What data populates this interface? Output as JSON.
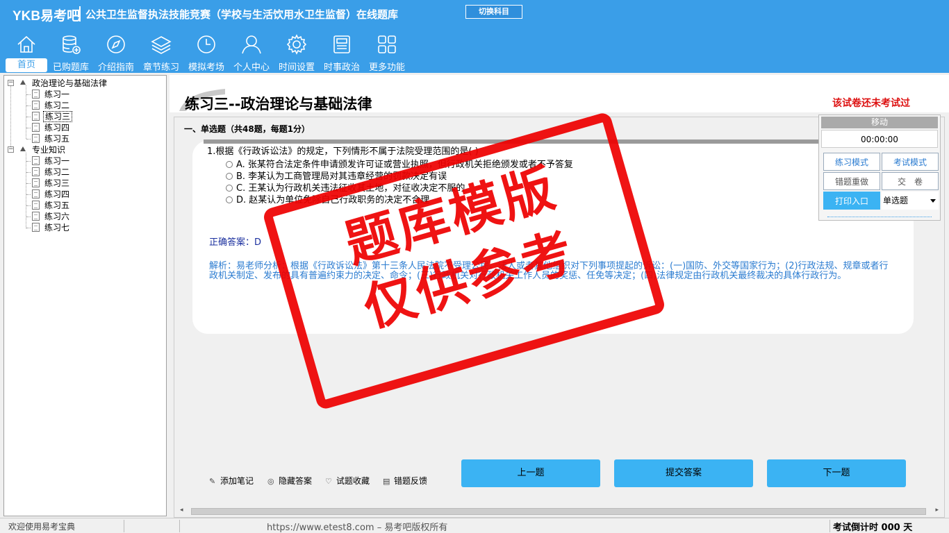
{
  "header": {
    "logo": "YKB易考吧",
    "title": "公共卫生监督执法技能竞赛（学校与生活饮用水卫生监督）在线题库",
    "switch_label": "切换科目"
  },
  "nav": [
    {
      "label": "首页",
      "icon": "home-icon"
    },
    {
      "label": "已购题库",
      "icon": "database-icon"
    },
    {
      "label": "介绍指南",
      "icon": "compass-icon"
    },
    {
      "label": "章节练习",
      "icon": "layers-icon"
    },
    {
      "label": "模拟考场",
      "icon": "clock-icon"
    },
    {
      "label": "个人中心",
      "icon": "user-icon"
    },
    {
      "label": "时间设置",
      "icon": "gear-icon"
    },
    {
      "label": "时事政治",
      "icon": "newspaper-icon"
    },
    {
      "label": "更多功能",
      "icon": "grid-icon"
    }
  ],
  "tree": {
    "groups": [
      {
        "label": "政治理论与基础法律",
        "items": [
          "练习一",
          "练习二",
          "练习三",
          "练习四",
          "练习五"
        ]
      },
      {
        "label": "专业知识",
        "items": [
          "练习一",
          "练习二",
          "练习三",
          "练习四",
          "练习五",
          "练习六",
          "练习七"
        ]
      }
    ],
    "selected": "练习三"
  },
  "exam": {
    "title": "练习三--政治理论与基础法律",
    "status": "该试卷还未考试过",
    "section": "一、单选题（共48题，每题1分）",
    "question": "1.根据《行政诉讼法》的规定，下列情形不属于法院受理范围的是( )",
    "options": [
      "A. 张某符合法定条件申请颁发许可证或营业执照，但行政机关拒绝颁发或者不予答复",
      "B. 李某认为工商管理局对其违章经营的罚款决定有误",
      "C. 王某认为行政机关违法征收其土地，对征收决定不服的",
      "D. 赵某认为单位免除自己行政职务的决定不合理"
    ],
    "answer": "正确答案：D",
    "analysis": "解析：易老师分析：根据《行政诉讼法》第十三条人民法院不受理公民、法人或者其他组织对下列事项提起的诉讼：(一)国防、外交等国家行为；(2)行政法规、规章或者行政机关制定、发布的具有普遍约束力的决定、命令；(三)行政机关对行政机关工作人员的奖惩、任免等决定；(四)法律规定由行政机关最终裁决的具体行政行为。"
  },
  "tools": [
    "添加笔记",
    "隐藏答案",
    "试题收藏",
    "错题反馈"
  ],
  "buttons": {
    "prev": "上一题",
    "submit": "提交答案",
    "next": "下一题"
  },
  "panel": {
    "header": "移动",
    "timer": "00:00:00",
    "practice_mode": "练习模式",
    "exam_mode": "考试模式",
    "redo_wrong": "错题重做",
    "hand_in": "交　卷",
    "print": "打印入口",
    "qtype": "单选题"
  },
  "watermark": {
    "line1": "题库模版",
    "line2": "仅供参考"
  },
  "statusbar": {
    "welcome": "欢迎使用易考宝典",
    "copyright": "https://www.etest8.com – 易考吧版权所有",
    "countdown": "考试倒计时 000 天"
  },
  "colors": {
    "header_bg": "#3a9ee8",
    "button_blue": "#3bb3f3",
    "status_red": "#dd1111",
    "stamp_red": "#ee0000"
  }
}
